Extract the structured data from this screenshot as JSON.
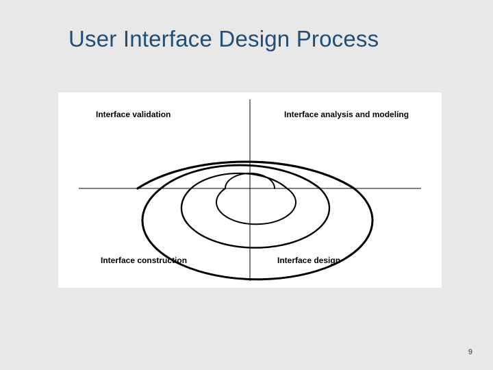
{
  "slide": {
    "title": "User Interface Design Process",
    "page_number": "9"
  },
  "diagram": {
    "quadrants": {
      "top_left": "Interface validation",
      "top_right": "Interface analysis and modeling",
      "bottom_left": "Interface construction",
      "bottom_right": "Interface design"
    }
  }
}
